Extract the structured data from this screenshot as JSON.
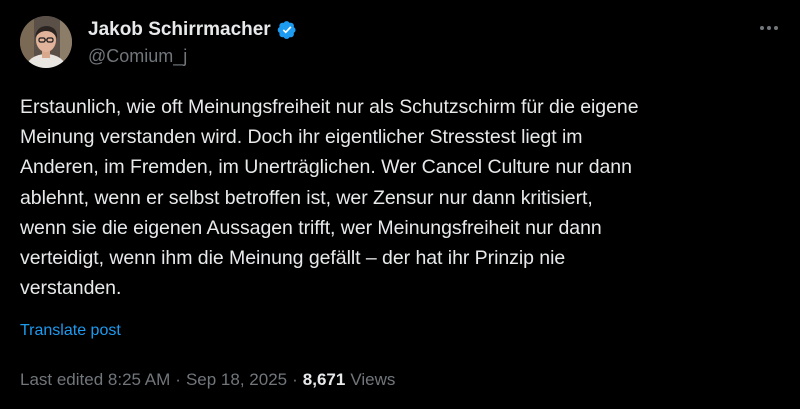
{
  "author": {
    "name": "Jakob Schirrmacher",
    "handle": "@Comium_j",
    "verified": true,
    "verified_icon": "verified-badge-icon"
  },
  "post": {
    "text": "Erstaunlich, wie oft Meinungsfreiheit nur als Schutzschirm für die eigene\nMeinung verstanden wird. Doch ihr eigentlicher Stresstest liegt im\nAnderen, im Fremden, im Unerträglichen. Wer Cancel Culture nur dann\nablehnt, wenn er selbst betroffen ist, wer Zensur nur dann kritisiert,\nwenn sie die eigenen Aussagen trifft, wer Meinungsfreiheit nur dann\nverteidigt, wenn ihm die Meinung gefällt – der hat ihr Prinzip nie\nverstanden.",
    "translate_label": "Translate post"
  },
  "meta": {
    "edited_label": "Last edited 8:25 AM",
    "separator": "·",
    "date": "Sep 18, 2025",
    "views_count": "8,671",
    "views_label": "Views"
  },
  "colors": {
    "background": "#000000",
    "text": "#e7e9ea",
    "secondary": "#71767b",
    "accent": "#1d9bf0"
  },
  "icons": {
    "more": "more-options-icon"
  }
}
